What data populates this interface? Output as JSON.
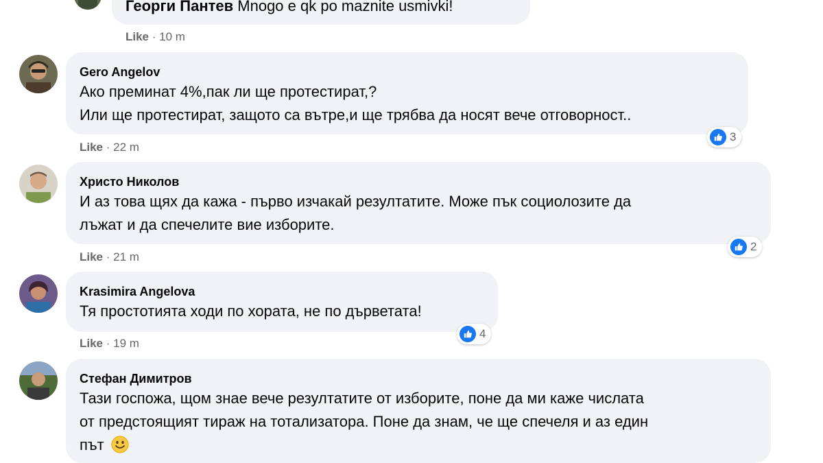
{
  "partial_reply": {
    "author": "Георги Пантев",
    "text": "Mnogo e qk po maznite usmivki!",
    "like_label": "Like",
    "time": "10 m"
  },
  "comments": [
    {
      "author": "Gero Angelov",
      "lines": [
        "Ако преминат 4%,пак ли ще протестират,?",
        "Или ще протестират, защото са вътре,и ще трябва да носят вече отговорност.."
      ],
      "like_label": "Like",
      "time": "22 m",
      "reactions": "3"
    },
    {
      "author": "Христо Николов",
      "lines": [
        "И аз това щях да кажа - първо изчакай резултатите. Може пък социолозите да",
        "лъжат и да спечелите вие изборите."
      ],
      "like_label": "Like",
      "time": "21 m",
      "reactions": "2"
    },
    {
      "author": "Krasimira Angelova",
      "lines": [
        "Тя простотията ходи по хората, не по дърветата!"
      ],
      "like_label": "Like",
      "time": "19 m",
      "reactions": "4"
    },
    {
      "author": "Стефан Димитров",
      "lines": [
        "Тази госпожа, щом знае вече резултатите от изборите, поне да ми каже числата",
        "от предстоящият тираж на тотализатора. Поне да знам, че ще спечеля и аз един",
        "път"
      ],
      "emoji": "smiling-face-emoji"
    }
  ],
  "colors": {
    "bubble": "#f0f2f5",
    "meta_text": "#65676b",
    "like_blue": "#1877f2"
  },
  "icons": {
    "reaction": "like-thumbs-up-icon"
  }
}
